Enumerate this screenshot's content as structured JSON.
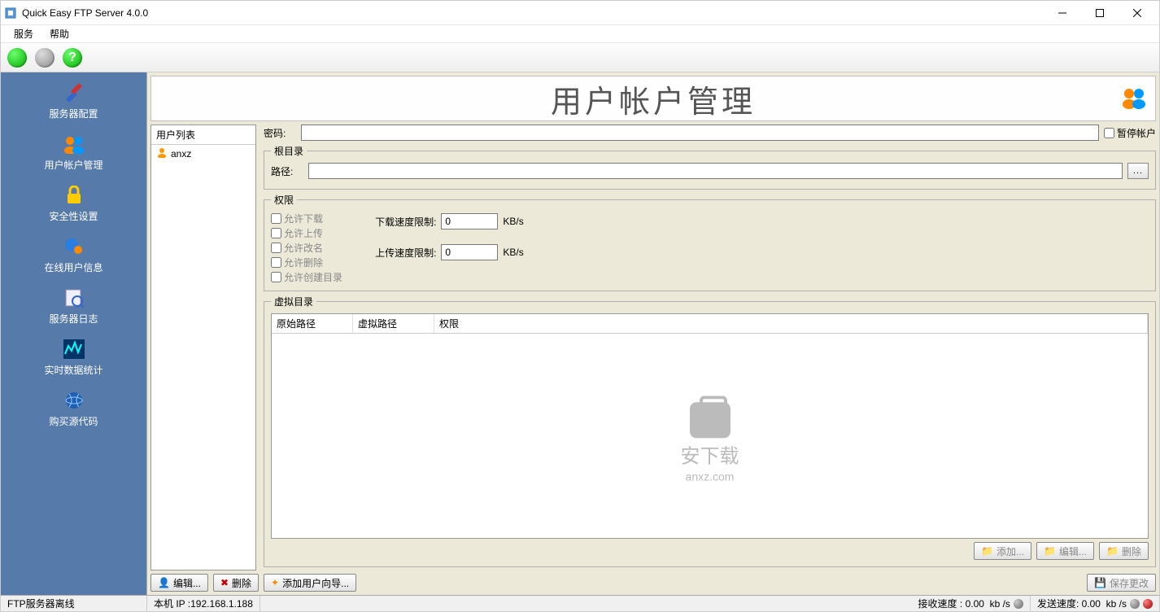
{
  "window": {
    "title": "Quick Easy FTP Server 4.0.0"
  },
  "menu": {
    "service": "服务",
    "help": "帮助"
  },
  "sidebar": {
    "items": [
      {
        "label": "服务器配置"
      },
      {
        "label": "用户帐户管理"
      },
      {
        "label": "安全性设置"
      },
      {
        "label": "在线用户信息"
      },
      {
        "label": "服务器日志"
      },
      {
        "label": "实时数据统计"
      },
      {
        "label": "购买源代码"
      }
    ]
  },
  "header": {
    "title": "用户帐户管理"
  },
  "userlist": {
    "title": "用户列表",
    "users": [
      "anxz"
    ]
  },
  "form": {
    "password_label": "密码:",
    "password_value": "",
    "pause_account": "暂停帐户",
    "root_group": "根目录",
    "path_label": "路径:",
    "path_value": "",
    "perm_group": "权限",
    "perms": {
      "download": "允许下载",
      "upload": "允许上传",
      "rename": "允许改名",
      "delete": "允许删除",
      "mkdir": "允许创建目录"
    },
    "dl_speed_label": "下载速度限制:",
    "ul_speed_label": "上传速度限制:",
    "dl_speed_value": "0",
    "ul_speed_value": "0",
    "speed_unit": "KB/s",
    "vdir_group": "虚拟目录",
    "vdir_cols": {
      "a": "原始路径",
      "b": "虚拟路径",
      "c": "权限"
    }
  },
  "buttons": {
    "edit": "编辑...",
    "delete": "删除",
    "add_user_wizard": "添加用户向导...",
    "add": "添加...",
    "edit2": "编辑...",
    "delete2": "删除",
    "save": "保存更改",
    "browse": "..."
  },
  "status": {
    "server": "FTP服务器离线",
    "ip": "本机 IP :192.168.1.188",
    "rx_label": "接收速度 :",
    "rx": "0.00",
    "tx_label": "发送速度:",
    "tx": "0.00",
    "unit": "kb /s"
  },
  "watermark": {
    "text": "安下载",
    "sub": "anxz.com"
  }
}
